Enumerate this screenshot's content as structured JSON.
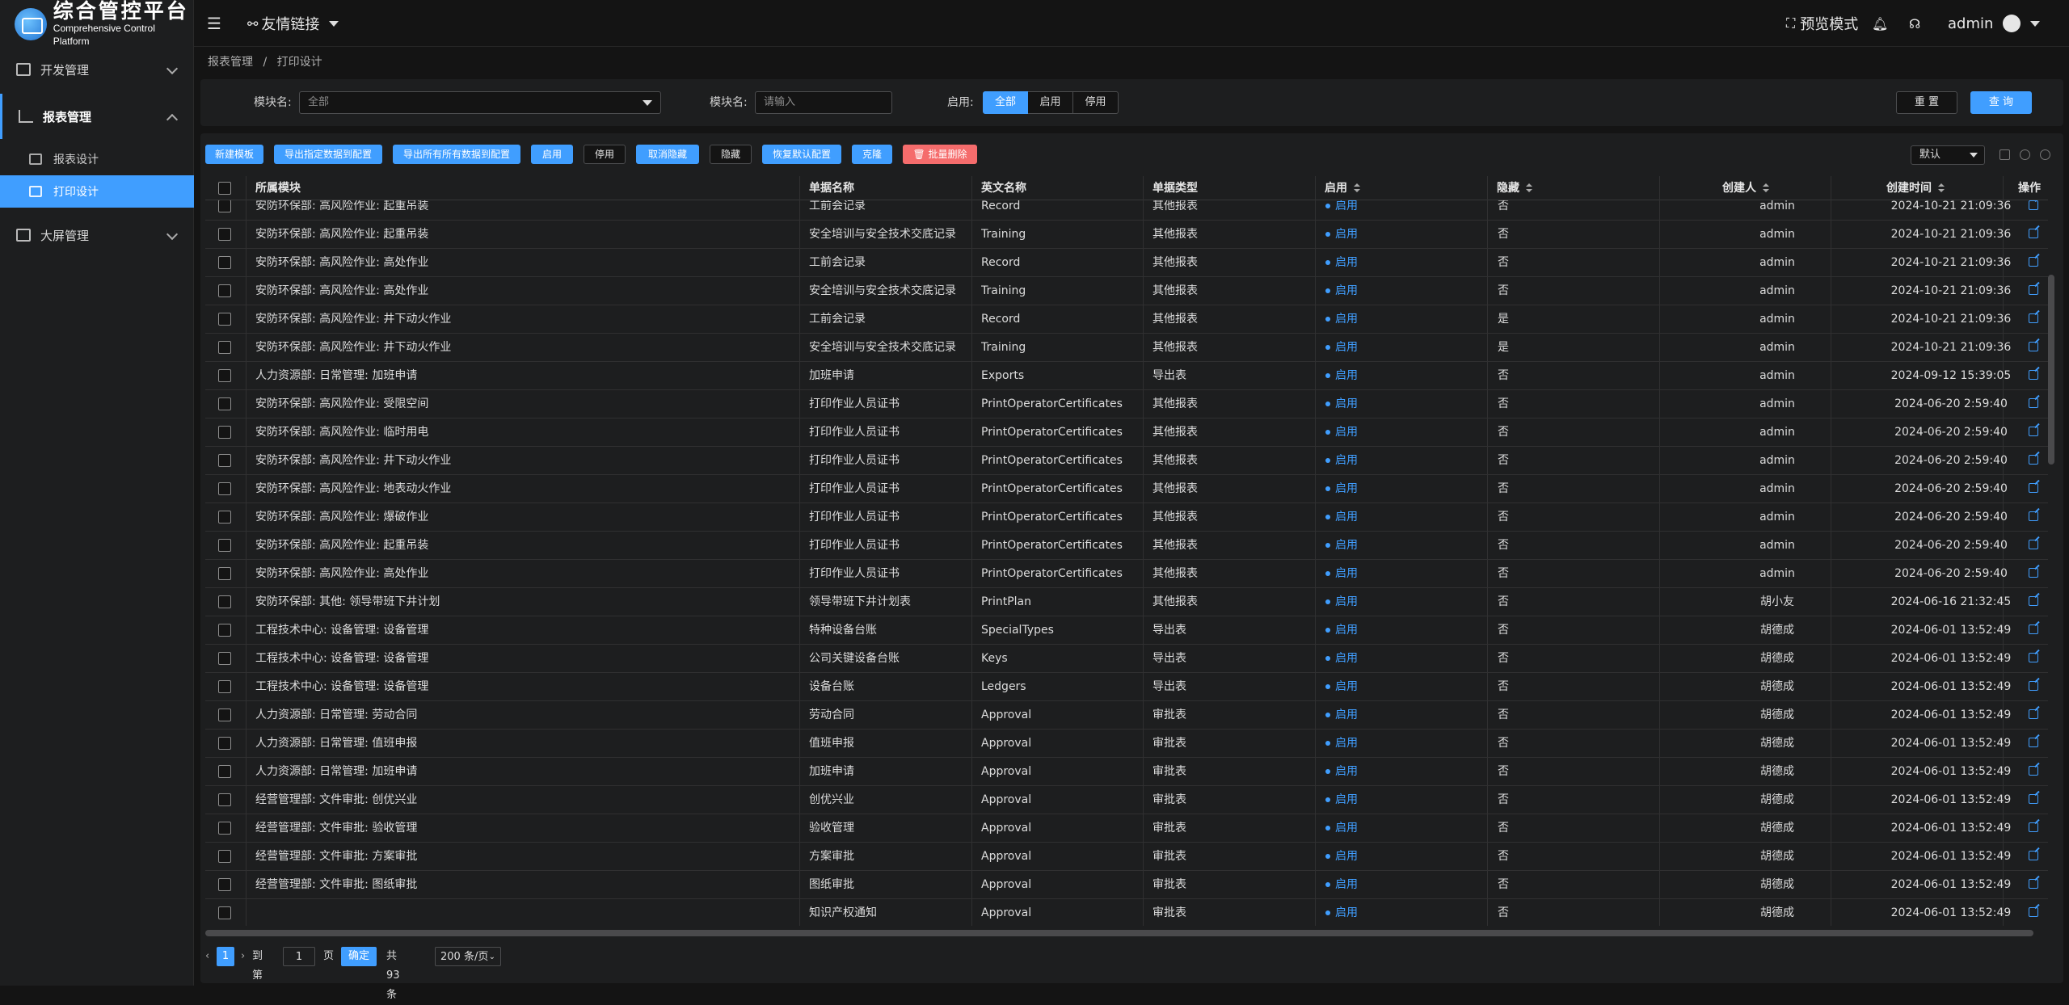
{
  "app": {
    "title": "综合管控平台",
    "subtitle": "Comprehensive Control Platform"
  },
  "sidebar": {
    "groups": [
      {
        "label": "开发管理"
      },
      {
        "label": "报表管理"
      },
      {
        "label": "大屏管理"
      }
    ],
    "sub_items": [
      {
        "label": "报表设计"
      },
      {
        "label": "打印设计"
      }
    ]
  },
  "header": {
    "links_label": "友情链接",
    "preview_label": "预览模式",
    "user": "admin"
  },
  "breadcrumb": [
    "报表管理",
    "/",
    "打印设计"
  ],
  "filter": {
    "module_label": "模块名:",
    "module_value": "全部",
    "module_name_label": "模块名:",
    "module_name_placeholder": "请输入",
    "enable_label": "启用:",
    "segments": [
      "全部",
      "启用",
      "停用"
    ],
    "reset_label": "重 置",
    "query_label": "查 询"
  },
  "toolbar": {
    "buttons": [
      "新建模板",
      "导出指定数据到配置",
      "导出所有所有数据到配置",
      "启用",
      "停用",
      "取消隐藏",
      "隐藏",
      "恢复默认配置",
      "克隆",
      "批量删除"
    ],
    "view_select": "默认"
  },
  "table": {
    "headers": [
      "所属模块",
      "单据名称",
      "英文名称",
      "单据类型",
      "启用",
      "隐藏",
      "创建人",
      "创建时间",
      "操作"
    ],
    "rows": [
      [
        "安防环保部: 高风险作业: 起重吊装",
        "工前会记录",
        "Record",
        "其他报表",
        "启用",
        "否",
        "admin",
        "2024-10-21 21:09:36"
      ],
      [
        "安防环保部: 高风险作业: 起重吊装",
        "安全培训与安全技术交底记录",
        "Training",
        "其他报表",
        "启用",
        "否",
        "admin",
        "2024-10-21 21:09:36"
      ],
      [
        "安防环保部: 高风险作业: 高处作业",
        "工前会记录",
        "Record",
        "其他报表",
        "启用",
        "否",
        "admin",
        "2024-10-21 21:09:36"
      ],
      [
        "安防环保部: 高风险作业: 高处作业",
        "安全培训与安全技术交底记录",
        "Training",
        "其他报表",
        "启用",
        "否",
        "admin",
        "2024-10-21 21:09:36"
      ],
      [
        "安防环保部: 高风险作业: 井下动火作业",
        "工前会记录",
        "Record",
        "其他报表",
        "启用",
        "是",
        "admin",
        "2024-10-21 21:09:36"
      ],
      [
        "安防环保部: 高风险作业: 井下动火作业",
        "安全培训与安全技术交底记录",
        "Training",
        "其他报表",
        "启用",
        "是",
        "admin",
        "2024-10-21 21:09:36"
      ],
      [
        "人力资源部: 日常管理: 加班申请",
        "加班申请",
        "Exports",
        "导出表",
        "启用",
        "否",
        "admin",
        "2024-09-12 15:39:05"
      ],
      [
        "安防环保部: 高风险作业: 受限空间",
        "打印作业人员证书",
        "PrintOperatorCertificates",
        "其他报表",
        "启用",
        "否",
        "admin",
        "2024-06-20 2:59:40"
      ],
      [
        "安防环保部: 高风险作业: 临时用电",
        "打印作业人员证书",
        "PrintOperatorCertificates",
        "其他报表",
        "启用",
        "否",
        "admin",
        "2024-06-20 2:59:40"
      ],
      [
        "安防环保部: 高风险作业: 井下动火作业",
        "打印作业人员证书",
        "PrintOperatorCertificates",
        "其他报表",
        "启用",
        "否",
        "admin",
        "2024-06-20 2:59:40"
      ],
      [
        "安防环保部: 高风险作业: 地表动火作业",
        "打印作业人员证书",
        "PrintOperatorCertificates",
        "其他报表",
        "启用",
        "否",
        "admin",
        "2024-06-20 2:59:40"
      ],
      [
        "安防环保部: 高风险作业: 爆破作业",
        "打印作业人员证书",
        "PrintOperatorCertificates",
        "其他报表",
        "启用",
        "否",
        "admin",
        "2024-06-20 2:59:40"
      ],
      [
        "安防环保部: 高风险作业: 起重吊装",
        "打印作业人员证书",
        "PrintOperatorCertificates",
        "其他报表",
        "启用",
        "否",
        "admin",
        "2024-06-20 2:59:40"
      ],
      [
        "安防环保部: 高风险作业: 高处作业",
        "打印作业人员证书",
        "PrintOperatorCertificates",
        "其他报表",
        "启用",
        "否",
        "admin",
        "2024-06-20 2:59:40"
      ],
      [
        "安防环保部: 其他: 领导带班下井计划",
        "领导带班下井计划表",
        "PrintPlan",
        "其他报表",
        "启用",
        "否",
        "胡小友",
        "2024-06-16 21:32:45"
      ],
      [
        "工程技术中心: 设备管理: 设备管理",
        "特种设备台账",
        "SpecialTypes",
        "导出表",
        "启用",
        "否",
        "胡德成",
        "2024-06-01 13:52:49"
      ],
      [
        "工程技术中心: 设备管理: 设备管理",
        "公司关键设备台账",
        "Keys",
        "导出表",
        "启用",
        "否",
        "胡德成",
        "2024-06-01 13:52:49"
      ],
      [
        "工程技术中心: 设备管理: 设备管理",
        "设备台账",
        "Ledgers",
        "导出表",
        "启用",
        "否",
        "胡德成",
        "2024-06-01 13:52:49"
      ],
      [
        "人力资源部: 日常管理: 劳动合同",
        "劳动合同",
        "Approval",
        "审批表",
        "启用",
        "否",
        "胡德成",
        "2024-06-01 13:52:49"
      ],
      [
        "人力资源部: 日常管理: 值班申报",
        "值班申报",
        "Approval",
        "审批表",
        "启用",
        "否",
        "胡德成",
        "2024-06-01 13:52:49"
      ],
      [
        "人力资源部: 日常管理: 加班申请",
        "加班申请",
        "Approval",
        "审批表",
        "启用",
        "否",
        "胡德成",
        "2024-06-01 13:52:49"
      ],
      [
        "经营管理部: 文件审批: 创优兴业",
        "创优兴业",
        "Approval",
        "审批表",
        "启用",
        "否",
        "胡德成",
        "2024-06-01 13:52:49"
      ],
      [
        "经营管理部: 文件审批: 验收管理",
        "验收管理",
        "Approval",
        "审批表",
        "启用",
        "否",
        "胡德成",
        "2024-06-01 13:52:49"
      ],
      [
        "经营管理部: 文件审批: 方案审批",
        "方案审批",
        "Approval",
        "审批表",
        "启用",
        "否",
        "胡德成",
        "2024-06-01 13:52:49"
      ],
      [
        "经营管理部: 文件审批: 图纸审批",
        "图纸审批",
        "Approval",
        "审批表",
        "启用",
        "否",
        "胡德成",
        "2024-06-01 13:52:49"
      ],
      [
        "",
        "知识产权通知",
        "Approval",
        "审批表",
        "启用",
        "否",
        "胡德成",
        "2024-06-01 13:52:49"
      ]
    ]
  },
  "pager": {
    "current_page": "1",
    "goto_label": "到第",
    "goto_value": "1",
    "page_unit": "页",
    "confirm_label": "确定",
    "total_label": "共 93 条",
    "page_size": "200 条/页"
  }
}
